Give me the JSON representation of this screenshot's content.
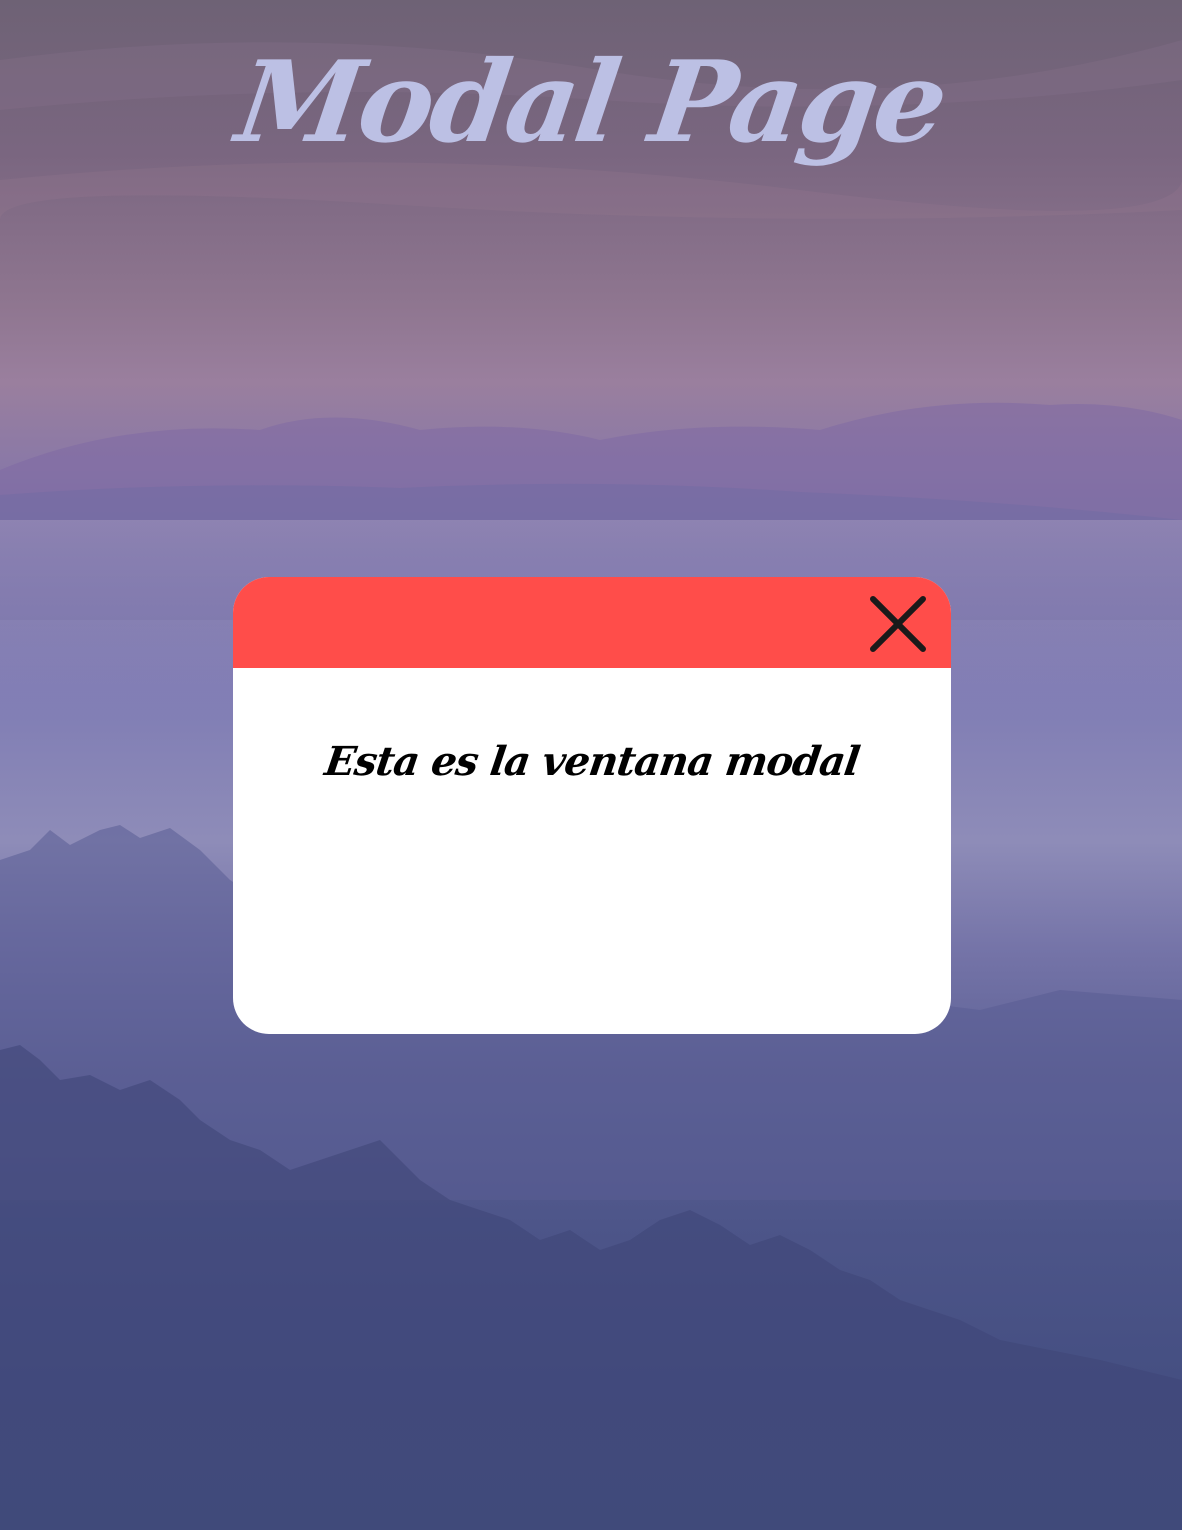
{
  "page": {
    "title": "Modal Page"
  },
  "modal": {
    "header_color": "#ff4d4a",
    "close_icon": "close-icon",
    "message": "Esta es la ventana modal"
  },
  "colors": {
    "title_color": "#bcc0e4",
    "modal_background": "#ffffff"
  }
}
